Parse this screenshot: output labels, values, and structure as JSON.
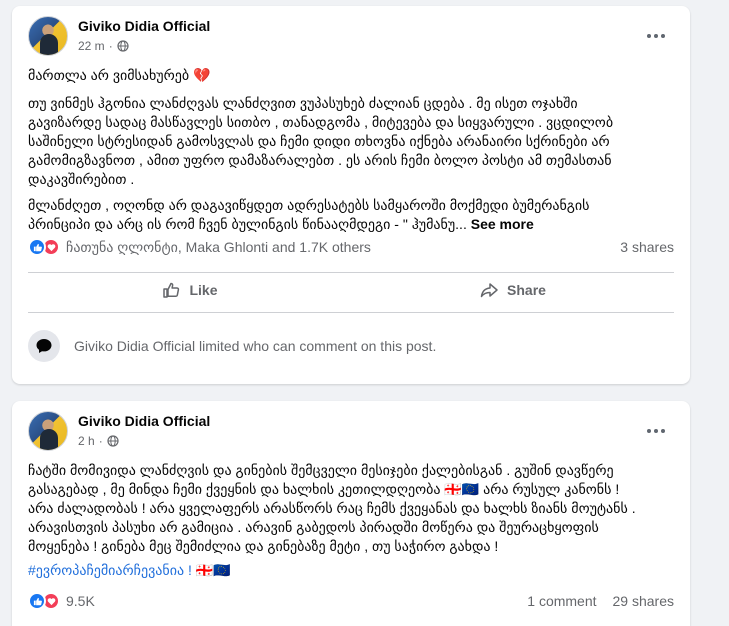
{
  "posts": [
    {
      "author": "Giviko Didia Official",
      "time": "22 m",
      "dot": "·",
      "first_line": "მართლა არ ვიმსახურებ",
      "first_line_emoji": "💔",
      "paragraph1": [
        "თუ ვინმეს ჰგონია ლანძღვას ლანძღვით ვუპასუხებ ძალიან ცდება . მე ისეთ ოჯახში",
        "გავიზარდე სადაც მასწავლეს სითბო , თანადგომა , მიტევება და სიყვარული . ვცდილობ",
        "საშინელი სტრესიდან გამოსვლას და ჩემი დიდი თხოვნა იქნება არანაირი სქრინები არ",
        "გამომიგზავნოთ , ამით უფრო დამაზარალებთ . ეს არის ჩემი ბოლო პოსტი ამ თემასთან",
        "დაკავშირებით ."
      ],
      "paragraph2": [
        "მლანძღეთ , ოღონდ არ დაგავიწყდეთ ადრესატებს სამყაროში მოქმედი ბუმერანგის",
        "პრინციპი და არც ის რომ ჩვენ ბულინგის წინააღმდეგი - \" ჰუმანუ..."
      ],
      "see_more": "See more",
      "reaction_names": "ჩათუნა ღლონტი, Maka Ghlonti and 1.7K others",
      "shares": "3 shares",
      "like_label": "Like",
      "share_label": "Share",
      "limited_text": "Giviko Didia Official limited who can comment on this post."
    },
    {
      "author": "Giviko Didia Official",
      "time": "2 h",
      "dot": "·",
      "lines": [
        "ჩატში მომივიდა ლანძღვის და გინების შემცველი მესიჯები ქალებისგან . გუშინ დავწერე",
        "გასაგებად , მე მინდა ჩემი ქვეყნის და ხალხის კეთილდღეობა 🇬🇪🇪🇺 არა რუსულ კანონს !",
        "არა ძალადობას ! არა ყველაფერს არასწორს რაც ჩემს ქვეყანას და ხალხს ზიანს მოუტანს .",
        "არავისთვის პასუხი არ გამიცია . არავინ გაბედოს პირადში მოწერა და შეურაცხყოფის",
        "მოყენება ! გინება მეც შემიძლია და გინებაზე მეტი , თუ საჭირო გახდა !"
      ],
      "hashtag": "#ევროპაჩემიარჩევანია ! 🇬🇪🇪🇺",
      "reaction_count": "9.5K",
      "comments": "1 comment",
      "shares": "29 shares"
    }
  ],
  "colors": {
    "like_blue": "#1877f2",
    "love_red": "#f33e58",
    "hashtag_blue": "#216fdb",
    "meta_gray": "#65676b"
  },
  "icons": [
    "globe-icon",
    "more-options-icon",
    "like-icon",
    "share-icon",
    "comment-bubble-icon",
    "like-reaction-icon",
    "love-reaction-icon"
  ]
}
